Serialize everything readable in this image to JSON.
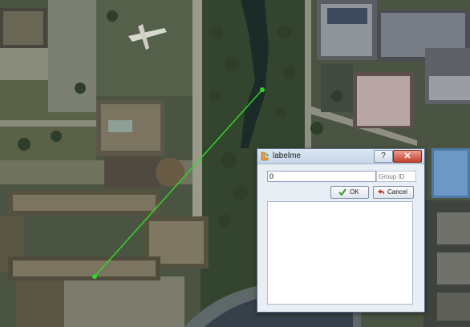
{
  "annotation": {
    "color": "#2fd628"
  },
  "dialog": {
    "title": "labelme",
    "help_label": "?",
    "close_label": "✕",
    "label_input": {
      "value": "0"
    },
    "group_id_input": {
      "placeholder": "Group ID",
      "value": ""
    },
    "ok_button": {
      "label": "OK",
      "icon": "check-icon"
    },
    "cancel_button": {
      "label": "Cancel",
      "icon": "undo-icon"
    },
    "label_list": {
      "items": []
    }
  }
}
